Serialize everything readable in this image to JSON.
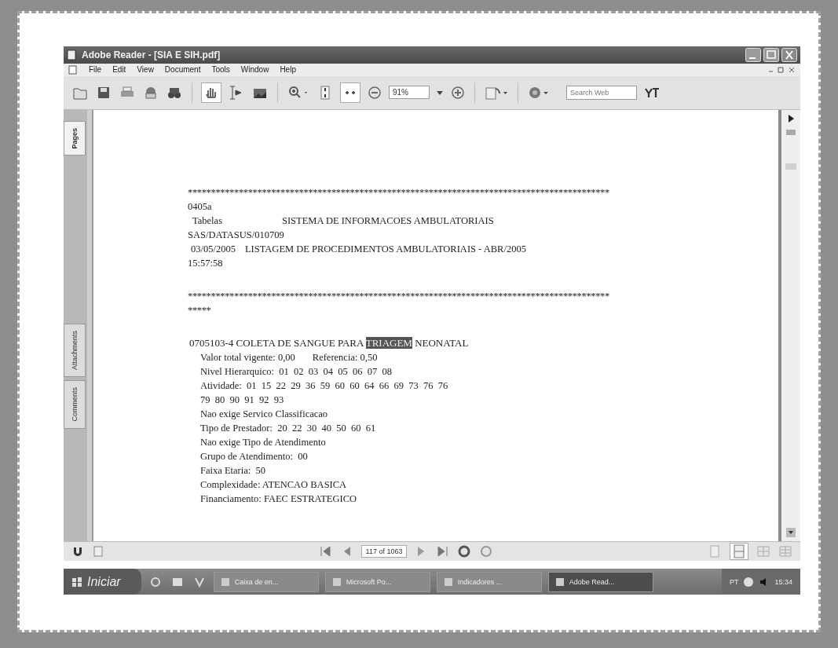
{
  "window": {
    "title": "Adobe Reader - [SIA E SIH.pdf]"
  },
  "menu": [
    "File",
    "Edit",
    "View",
    "Document",
    "Tools",
    "Window",
    "Help"
  ],
  "toolbar": {
    "zoom": "91%",
    "search": {
      "placeholder": "Search Web"
    }
  },
  "side_tabs": [
    {
      "label": "Pages",
      "selected": true
    },
    {
      "label": "Attachments",
      "selected": false
    },
    {
      "label": "Comments",
      "selected": false
    }
  ],
  "document": {
    "lines": [
      {
        "kind": "rule",
        "texts": [
          "*******************************************************************************************"
        ]
      },
      {
        "kind": "plain",
        "texts": [
          "0405a"
        ]
      },
      {
        "kind": "tabbed",
        "texts": [
          "Tabelas",
          "SISTEMA DE INFORMACOES AMBULATORIAIS"
        ]
      },
      {
        "kind": "plain",
        "texts": [
          "SAS/DATASUS/010709"
        ]
      },
      {
        "kind": "spaced",
        "texts": [
          "03/05/2005",
          "LISTAGEM DE PROCEDIMENTOS AMBULATORIAIS - ABR/2005"
        ]
      },
      {
        "kind": "plain",
        "texts": [
          "15:57:58"
        ]
      },
      {
        "kind": "blank"
      },
      {
        "kind": "rule",
        "texts": [
          "*******************************************************************************************"
        ]
      },
      {
        "kind": "rule",
        "texts": [
          "*****"
        ]
      },
      {
        "kind": "blank"
      },
      {
        "kind": "heading",
        "parts": [
          {
            "text": "0705103-4 COLETA DE SANGUE PARA ",
            "highlighted": false
          },
          {
            "text": "TRIAGEM",
            "highlighted": true
          },
          {
            "text": " NEONATAL",
            "highlighted": false
          }
        ]
      },
      {
        "kind": "spaced-field",
        "texts": [
          "Valor total vigente: 0,00",
          "Referencia: 0,50"
        ]
      },
      {
        "kind": "field",
        "texts": [
          "Nivel Hierarquico:  01  02  03  04  05  06  07  08"
        ]
      },
      {
        "kind": "field",
        "texts": [
          "Atividade:  01  15  22  29  36  59  60  60  64  66  69  73  76  76"
        ]
      },
      {
        "kind": "field",
        "texts": [
          "79  80  90  91  92  93"
        ]
      },
      {
        "kind": "field",
        "texts": [
          "Nao exige Servico Classificacao"
        ]
      },
      {
        "kind": "field",
        "texts": [
          "Tipo de Prestador:  20  22  30  40  50  60  61"
        ]
      },
      {
        "kind": "field",
        "texts": [
          "Nao exige Tipo de Atendimento"
        ]
      },
      {
        "kind": "field",
        "texts": [
          "Grupo de Atendimento:  00"
        ]
      },
      {
        "kind": "field",
        "texts": [
          "Faixa Etaria:  50"
        ]
      },
      {
        "kind": "field",
        "texts": [
          "Complexidade: ATENCAO BASICA"
        ]
      },
      {
        "kind": "field",
        "texts": [
          "Financiamento: FAEC ESTRATEGICO"
        ]
      }
    ]
  },
  "navigation": {
    "page": "117 of 1063"
  },
  "taskbar": {
    "start": "Iniciar",
    "tasks": [
      {
        "label": "Caixa de en...",
        "selected": false
      },
      {
        "label": "Microsoft Po...",
        "selected": false
      },
      {
        "label": "Indicadores ...",
        "selected": false
      },
      {
        "label": "Adobe Read...",
        "selected": true
      }
    ],
    "language": "PT",
    "clock": "15:34"
  }
}
